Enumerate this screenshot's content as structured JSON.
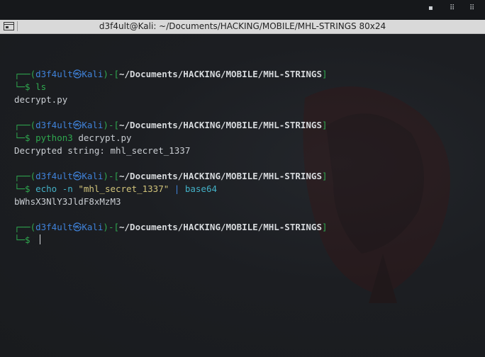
{
  "window": {
    "title": "d3f4ult@Kali: ~/Documents/HACKING/MOBILE/MHL-STRINGS 80x24"
  },
  "prompt": {
    "open": "┌──(",
    "user": "d3f4ult",
    "at": "㉿",
    "host": "Kali",
    "mid": ")-[",
    "path": "~/Documents/HACKING/MOBILE/MHL-STRINGS",
    "close": "]",
    "second": "└─$ "
  },
  "commands": [
    {
      "parts": [
        {
          "text": "ls",
          "color": "cmd"
        }
      ],
      "output": "decrypt.py"
    },
    {
      "parts": [
        {
          "text": "python3",
          "color": "cmd"
        },
        {
          "text": " ",
          "color": "plain"
        },
        {
          "text": "decrypt.py",
          "color": "plain"
        }
      ],
      "output": "Decrypted string: mhl_secret_1337"
    },
    {
      "parts": [
        {
          "text": "echo",
          "color": "cyan"
        },
        {
          "text": " -n ",
          "color": "cyan"
        },
        {
          "text": "\"mhl_secret_1337\"",
          "color": "yellow"
        },
        {
          "text": " | ",
          "color": "b"
        },
        {
          "text": "base64",
          "color": "cyan"
        }
      ],
      "output": "bWhsX3NlY3JldF8xMzM3"
    }
  ]
}
